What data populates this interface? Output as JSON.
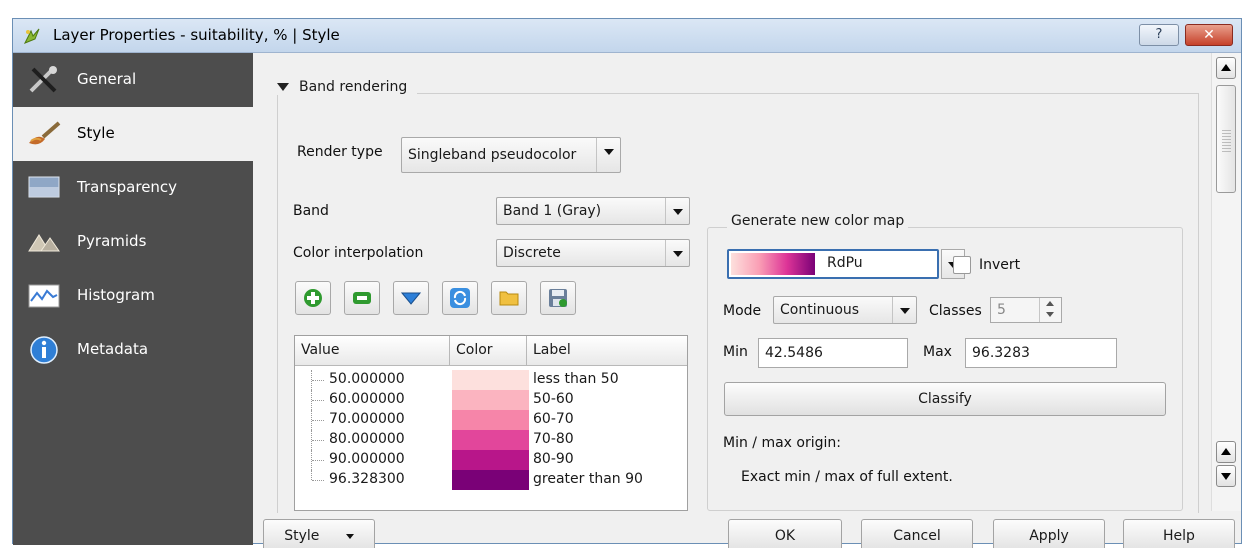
{
  "window": {
    "title": "Layer Properties - suitability, % | Style",
    "help_label": "?",
    "close_label": "✕"
  },
  "sidebar": {
    "items": [
      {
        "label": "General",
        "icon": "tools-icon"
      },
      {
        "label": "Style",
        "icon": "paintbrush-icon"
      },
      {
        "label": "Transparency",
        "icon": "transparency-icon"
      },
      {
        "label": "Pyramids",
        "icon": "pyramids-icon"
      },
      {
        "label": "Histogram",
        "icon": "histogram-icon"
      },
      {
        "label": "Metadata",
        "icon": "info-icon"
      }
    ],
    "active": "Style",
    "bg_color": "#4d4d4d"
  },
  "band_rendering": {
    "section_title": "Band rendering",
    "render_type_label": "Render type",
    "render_type_value": "Singleband pseudocolor",
    "band_label": "Band",
    "band_value": "Band 1 (Gray)",
    "interp_label": "Color interpolation",
    "interp_value": "Discrete",
    "toolbar_icons": [
      "add-icon",
      "remove-icon",
      "sort-down-icon",
      "refresh-icon",
      "open-folder-icon",
      "save-icon"
    ]
  },
  "table": {
    "headers": [
      "Value",
      "Color",
      "Label"
    ],
    "rows": [
      {
        "value": "50.000000",
        "color": "#fde0dd",
        "label": "less than 50"
      },
      {
        "value": "60.000000",
        "color": "#fbb4c0",
        "label": "50-60"
      },
      {
        "value": "70.000000",
        "color": "#f685a9",
        "label": "60-70"
      },
      {
        "value": "80.000000",
        "color": "#e2469b",
        "label": "70-80"
      },
      {
        "value": "90.000000",
        "color": "#b8168a",
        "label": "80-90"
      },
      {
        "value": "96.328300",
        "color": "#7a0177",
        "label": "greater than 90"
      }
    ]
  },
  "color_map": {
    "group_title": "Generate new color map",
    "ramp_name": "RdPu",
    "invert_label": "Invert",
    "mode_label": "Mode",
    "mode_value": "Continuous",
    "classes_label": "Classes",
    "classes_value": "5",
    "min_label": "Min",
    "min_value": "42.5486",
    "max_label": "Max",
    "max_value": "96.3283",
    "classify_label": "Classify",
    "origin_label": "Min / max origin:",
    "origin_text": "Exact min / max of full extent."
  },
  "footer": {
    "style_label": "Style",
    "ok_label": "OK",
    "cancel_label": "Cancel",
    "apply_label": "Apply",
    "help_label": "Help"
  }
}
